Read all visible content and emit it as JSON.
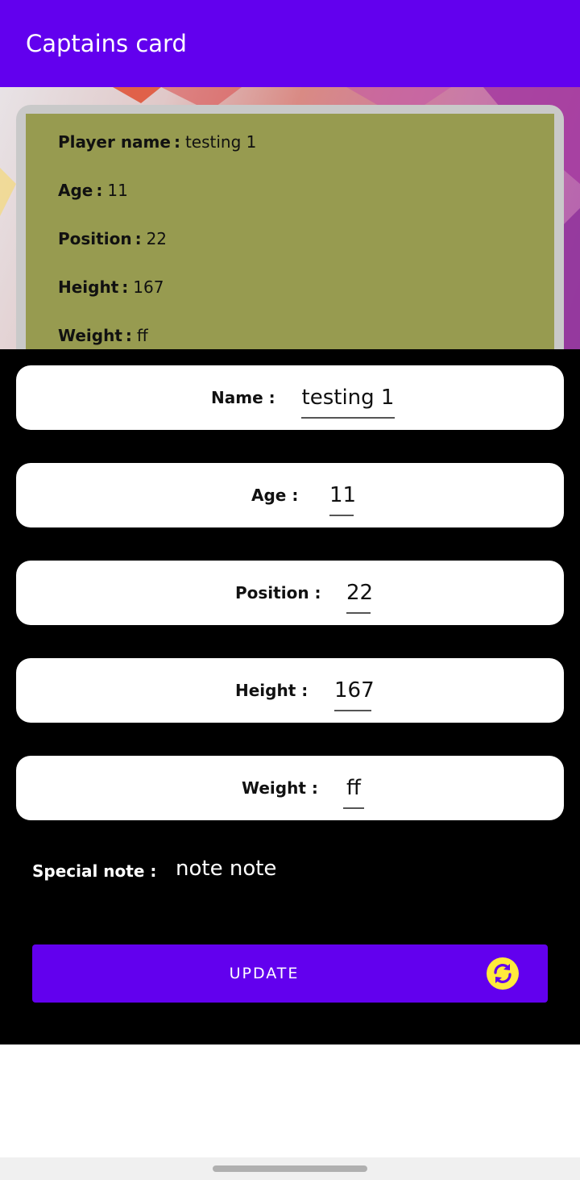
{
  "appbar": {
    "title": "Captains card"
  },
  "card": {
    "player_name_label": "Player name",
    "player_name_value": "testing 1",
    "age_label": "Age",
    "age_value": "11",
    "position_label": "Position",
    "position_value": "22",
    "height_label": "Height",
    "height_value": "167",
    "weight_label": "Weight",
    "weight_value": "ff",
    "separator": ":"
  },
  "form": {
    "name_label": "Name :",
    "name_value": "testing 1",
    "age_label": "Age :",
    "age_value": "11",
    "position_label": "Position :",
    "position_value": "22",
    "height_label": "Height :",
    "height_value": "167",
    "weight_label": "Weight :",
    "weight_value": "ff",
    "special_note_label": "Special note :",
    "special_note_value": "note note"
  },
  "update_button": {
    "label": "UPDATE",
    "icon": "refresh-icon"
  },
  "colors": {
    "primary": "#6200ee",
    "card": "#979b50",
    "icon_yellow": "#ffeb3b"
  }
}
